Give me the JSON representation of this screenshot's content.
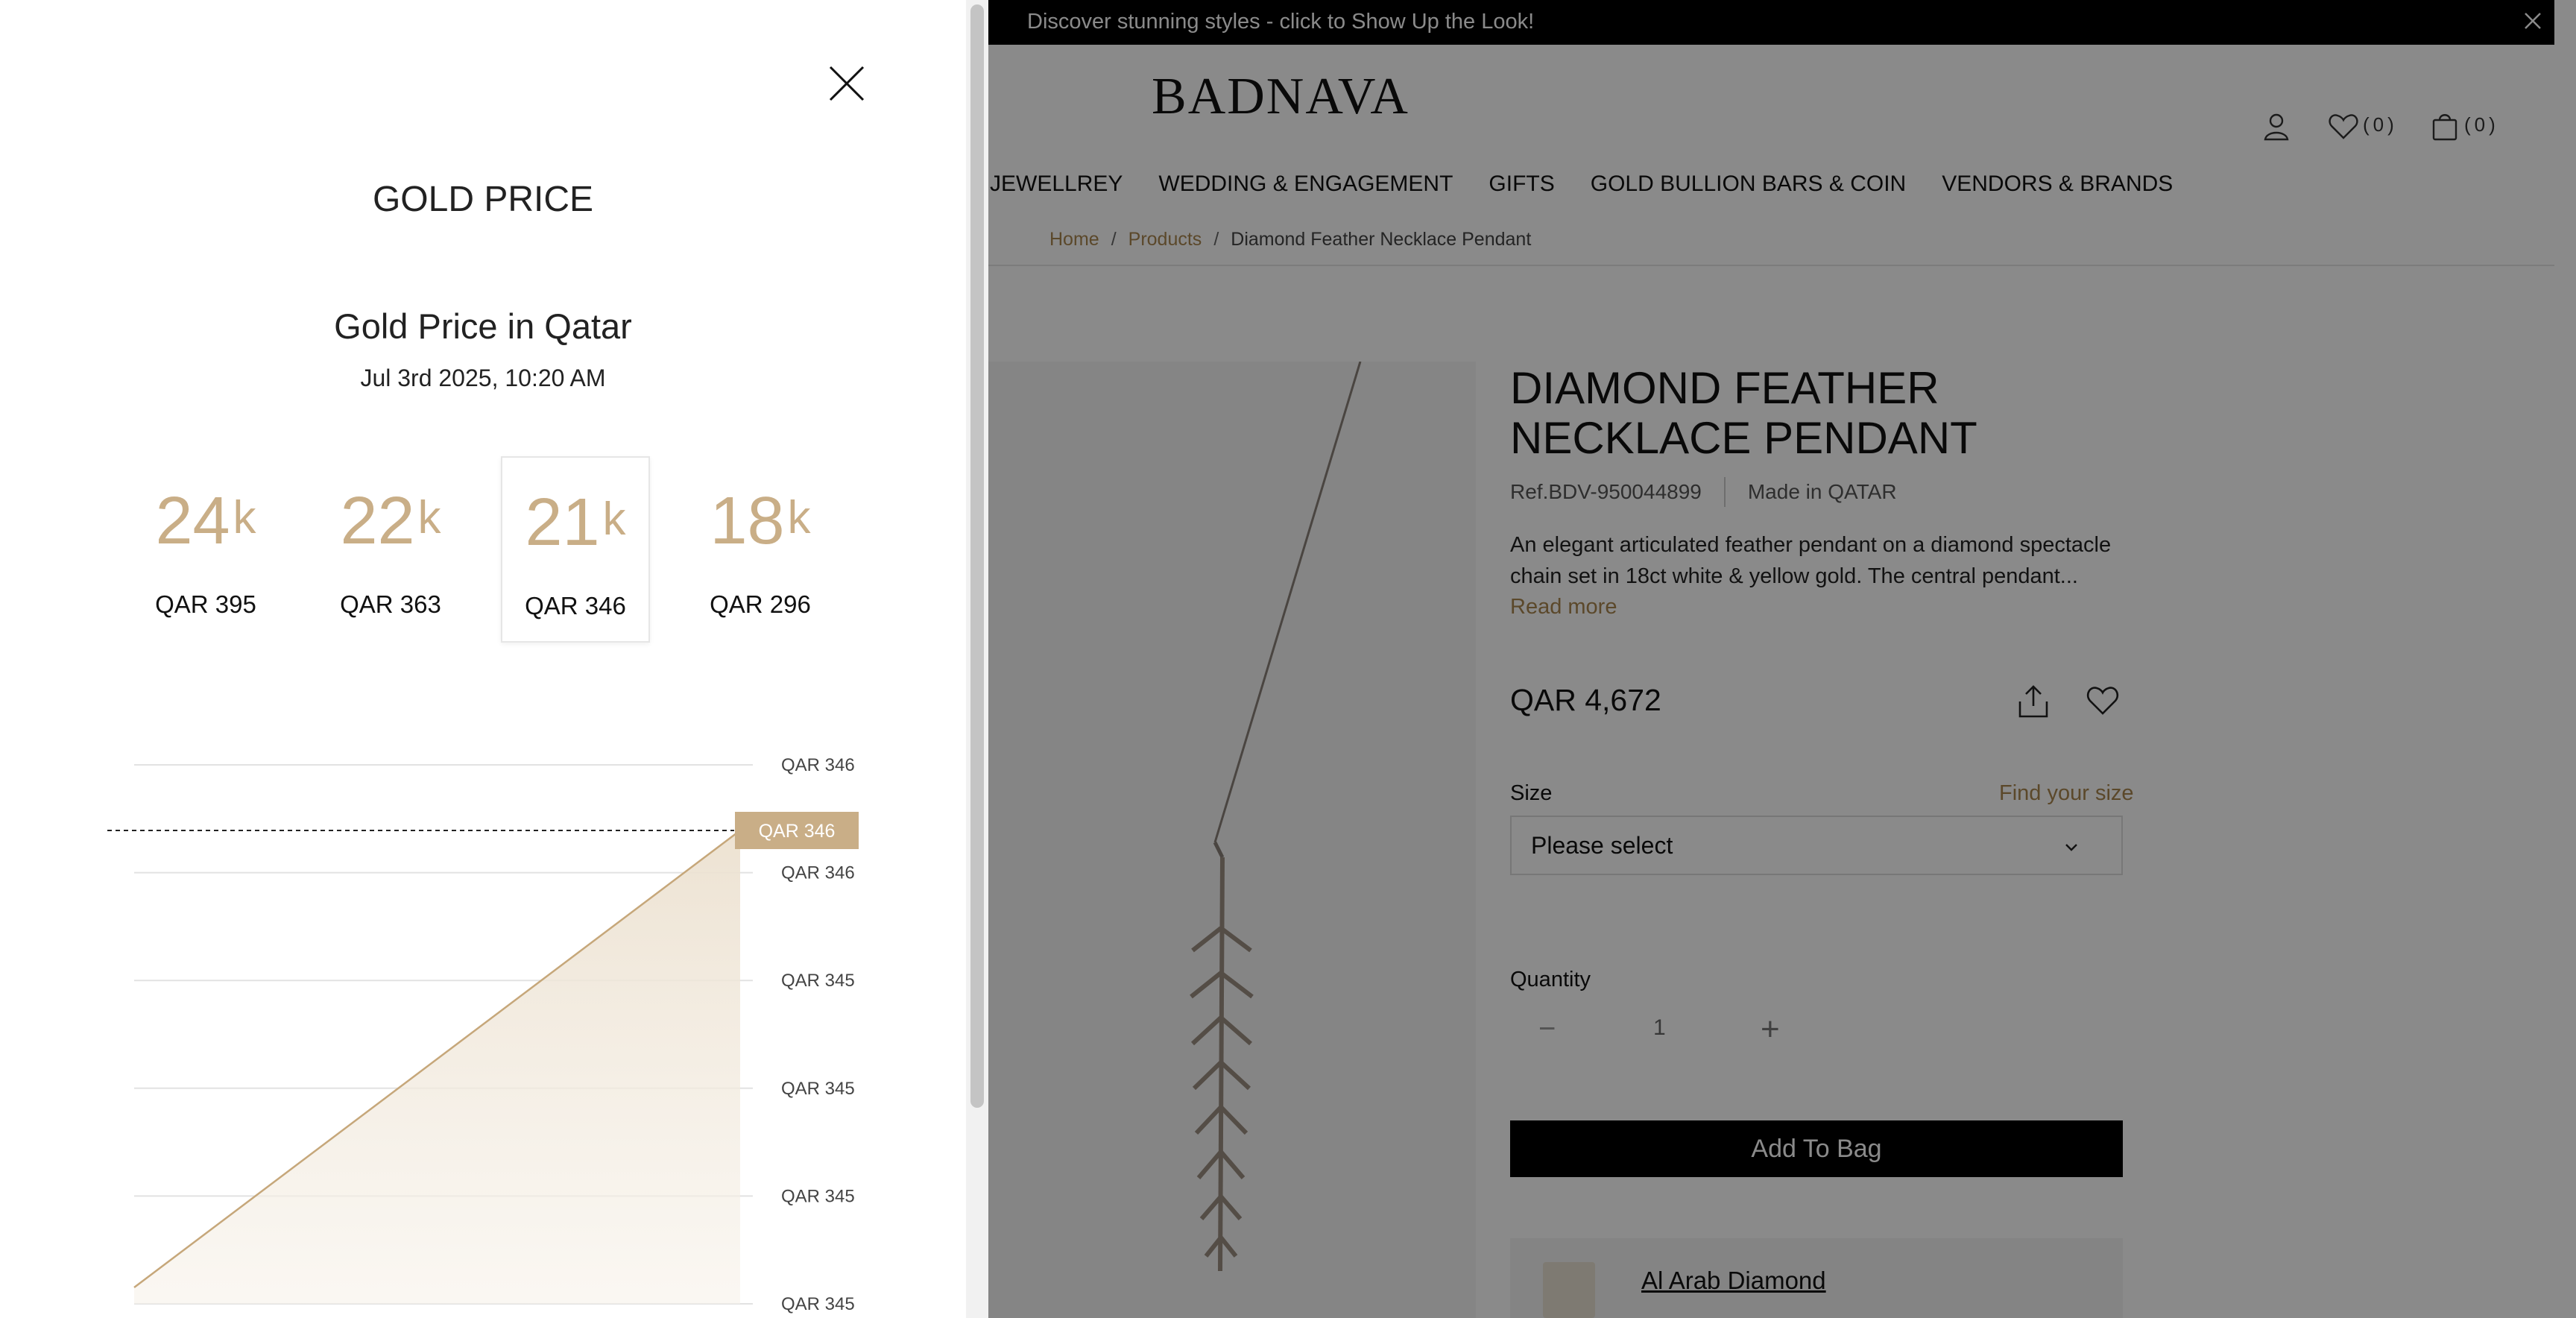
{
  "announcement": {
    "text": "Discover stunning styles - click to Show Up the Look!"
  },
  "header": {
    "logo": "BADNAVA",
    "wishlist_count": "(0)",
    "bag_count": "(0)"
  },
  "nav": {
    "items": [
      "JEWELLREY",
      "WEDDING & ENGAGEMENT",
      "GIFTS",
      "GOLD BULLION BARS & COIN",
      "VENDORS & BRANDS"
    ]
  },
  "breadcrumb": {
    "home": "Home",
    "products": "Products",
    "current": "Diamond Feather Necklace Pendant",
    "separator": "/"
  },
  "product": {
    "title_line1": "DIAMOND FEATHER",
    "title_line2": "NECKLACE PENDANT",
    "ref": "Ref.BDV-950044899",
    "made_in": "Made in QATAR",
    "desc_line1": "An elegant articulated feather pendant on a diamond spectacle",
    "desc_line2": "chain set in 18ct white & yellow gold. The central pendant...",
    "read_more": "Read more",
    "price": "QAR 4,672",
    "size_label": "Size",
    "size_help": "Find your size",
    "size_value": "Please select",
    "qty_label": "Quantity",
    "qty_minus": "−",
    "qty_value": "1",
    "qty_plus": "+",
    "add_to_bag": "Add To Bag",
    "vendor_name": "Al Arab Diamond"
  },
  "gold_panel": {
    "title": "GOLD PRICE",
    "subtitle": "Gold Price in Qatar",
    "date": "Jul 3rd 2025, 10:20 AM",
    "karats": [
      {
        "num": "24",
        "unit": "k",
        "price": "QAR 395"
      },
      {
        "num": "22",
        "unit": "k",
        "price": "QAR 363"
      },
      {
        "num": "21",
        "unit": "k",
        "price": "QAR 346",
        "selected": true
      },
      {
        "num": "18",
        "unit": "k",
        "price": "QAR 296"
      }
    ],
    "current_badge": "QAR 346"
  },
  "colors": {
    "gold": "#c9ae87",
    "gold_dark": "#a8854e",
    "black": "#000000"
  },
  "chart_data": {
    "type": "area",
    "y_tick_labels": [
      "QAR 346",
      "QAR 346",
      "QAR 345",
      "QAR 345",
      "QAR 345",
      "QAR 345"
    ],
    "series": [
      {
        "values": [
          345.0,
          346.0
        ]
      }
    ],
    "current_value_label": "QAR 346",
    "grid": true
  }
}
